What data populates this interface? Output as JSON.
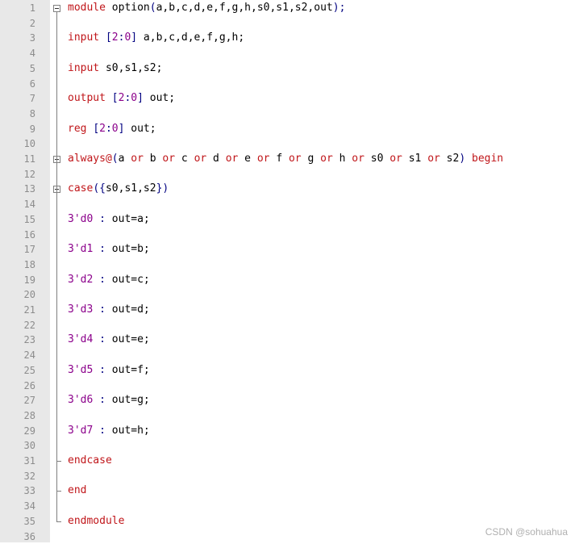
{
  "editor": {
    "line_numbers": [
      "1",
      "2",
      "3",
      "4",
      "5",
      "6",
      "7",
      "8",
      "9",
      "10",
      "11",
      "12",
      "13",
      "14",
      "15",
      "16",
      "17",
      "18",
      "19",
      "20",
      "21",
      "22",
      "23",
      "24",
      "25",
      "26",
      "27",
      "28",
      "29",
      "30",
      "31",
      "32",
      "33",
      "34",
      "35",
      "36"
    ],
    "code_lines": [
      {
        "line": 1,
        "tokens": [
          {
            "t": "kw",
            "v": "module"
          },
          {
            "t": "plain",
            "v": " option"
          },
          {
            "t": "op",
            "v": "("
          },
          {
            "t": "plain",
            "v": "a,b,c,d,e,f,g,h,s0,s1,s2,out"
          },
          {
            "t": "op",
            "v": ");"
          }
        ]
      },
      {
        "line": 3,
        "tokens": [
          {
            "t": "kw",
            "v": "input"
          },
          {
            "t": "plain",
            "v": " "
          },
          {
            "t": "op",
            "v": "["
          },
          {
            "t": "num",
            "v": "2"
          },
          {
            "t": "op",
            "v": ":"
          },
          {
            "t": "num",
            "v": "0"
          },
          {
            "t": "op",
            "v": "]"
          },
          {
            "t": "plain",
            "v": " a,b,c,d,e,f,g,h;"
          }
        ]
      },
      {
        "line": 5,
        "tokens": [
          {
            "t": "kw",
            "v": "input"
          },
          {
            "t": "plain",
            "v": " s0,s1,s2;"
          }
        ]
      },
      {
        "line": 7,
        "tokens": [
          {
            "t": "kw",
            "v": "output"
          },
          {
            "t": "plain",
            "v": " "
          },
          {
            "t": "op",
            "v": "["
          },
          {
            "t": "num",
            "v": "2"
          },
          {
            "t": "op",
            "v": ":"
          },
          {
            "t": "num",
            "v": "0"
          },
          {
            "t": "op",
            "v": "]"
          },
          {
            "t": "plain",
            "v": " out;"
          }
        ]
      },
      {
        "line": 9,
        "tokens": [
          {
            "t": "kw",
            "v": "reg"
          },
          {
            "t": "plain",
            "v": " "
          },
          {
            "t": "op",
            "v": "["
          },
          {
            "t": "num",
            "v": "2"
          },
          {
            "t": "op",
            "v": ":"
          },
          {
            "t": "num",
            "v": "0"
          },
          {
            "t": "op",
            "v": "]"
          },
          {
            "t": "plain",
            "v": " out;"
          }
        ]
      },
      {
        "line": 11,
        "tokens": [
          {
            "t": "kw",
            "v": "always@"
          },
          {
            "t": "op",
            "v": "("
          },
          {
            "t": "plain",
            "v": "a "
          },
          {
            "t": "kw",
            "v": "or"
          },
          {
            "t": "plain",
            "v": " b "
          },
          {
            "t": "kw",
            "v": "or"
          },
          {
            "t": "plain",
            "v": " c "
          },
          {
            "t": "kw",
            "v": "or"
          },
          {
            "t": "plain",
            "v": " d "
          },
          {
            "t": "kw",
            "v": "or"
          },
          {
            "t": "plain",
            "v": " e "
          },
          {
            "t": "kw",
            "v": "or"
          },
          {
            "t": "plain",
            "v": " f "
          },
          {
            "t": "kw",
            "v": "or"
          },
          {
            "t": "plain",
            "v": " g "
          },
          {
            "t": "kw",
            "v": "or"
          },
          {
            "t": "plain",
            "v": " h "
          },
          {
            "t": "kw",
            "v": "or"
          },
          {
            "t": "plain",
            "v": " s0 "
          },
          {
            "t": "kw",
            "v": "or"
          },
          {
            "t": "plain",
            "v": " s1 "
          },
          {
            "t": "kw",
            "v": "or"
          },
          {
            "t": "plain",
            "v": " s2"
          },
          {
            "t": "op",
            "v": ")"
          },
          {
            "t": "plain",
            "v": " "
          },
          {
            "t": "kw",
            "v": "begin"
          }
        ]
      },
      {
        "line": 13,
        "tokens": [
          {
            "t": "kw",
            "v": "case"
          },
          {
            "t": "op",
            "v": "({"
          },
          {
            "t": "plain",
            "v": "s0,s1,s2"
          },
          {
            "t": "op",
            "v": "})"
          }
        ]
      },
      {
        "line": 15,
        "tokens": [
          {
            "t": "num",
            "v": "3'd0"
          },
          {
            "t": "plain",
            "v": " "
          },
          {
            "t": "op",
            "v": ":"
          },
          {
            "t": "plain",
            "v": " out=a;"
          }
        ]
      },
      {
        "line": 17,
        "tokens": [
          {
            "t": "num",
            "v": "3'd1"
          },
          {
            "t": "plain",
            "v": " "
          },
          {
            "t": "op",
            "v": ":"
          },
          {
            "t": "plain",
            "v": " out=b;"
          }
        ]
      },
      {
        "line": 19,
        "tokens": [
          {
            "t": "num",
            "v": "3'd2"
          },
          {
            "t": "plain",
            "v": " "
          },
          {
            "t": "op",
            "v": ":"
          },
          {
            "t": "plain",
            "v": " out=c;"
          }
        ]
      },
      {
        "line": 21,
        "tokens": [
          {
            "t": "num",
            "v": "3'd3"
          },
          {
            "t": "plain",
            "v": " "
          },
          {
            "t": "op",
            "v": ":"
          },
          {
            "t": "plain",
            "v": " out=d;"
          }
        ]
      },
      {
        "line": 23,
        "tokens": [
          {
            "t": "num",
            "v": "3'd4"
          },
          {
            "t": "plain",
            "v": " "
          },
          {
            "t": "op",
            "v": ":"
          },
          {
            "t": "plain",
            "v": " out=e;"
          }
        ]
      },
      {
        "line": 25,
        "tokens": [
          {
            "t": "num",
            "v": "3'd5"
          },
          {
            "t": "plain",
            "v": " "
          },
          {
            "t": "op",
            "v": ":"
          },
          {
            "t": "plain",
            "v": " out=f;"
          }
        ]
      },
      {
        "line": 27,
        "tokens": [
          {
            "t": "num",
            "v": "3'd6"
          },
          {
            "t": "plain",
            "v": " "
          },
          {
            "t": "op",
            "v": ":"
          },
          {
            "t": "plain",
            "v": " out=g;"
          }
        ]
      },
      {
        "line": 29,
        "tokens": [
          {
            "t": "num",
            "v": "3'd7"
          },
          {
            "t": "plain",
            "v": " "
          },
          {
            "t": "op",
            "v": ":"
          },
          {
            "t": "plain",
            "v": " out=h;"
          }
        ]
      },
      {
        "line": 31,
        "tokens": [
          {
            "t": "kw",
            "v": "endcase"
          }
        ]
      },
      {
        "line": 33,
        "tokens": [
          {
            "t": "kw",
            "v": "end"
          }
        ]
      },
      {
        "line": 35,
        "tokens": [
          {
            "t": "kw",
            "v": "endmodule"
          }
        ]
      }
    ],
    "fold_markers": [
      {
        "line": 1,
        "icon": "fold-minus-icon"
      },
      {
        "line": 11,
        "icon": "fold-minus-icon"
      },
      {
        "line": 13,
        "icon": "fold-minus-icon"
      }
    ],
    "fold_ends": [
      31,
      33,
      35
    ],
    "colors": {
      "keyword": "#c0161a",
      "number": "#8b008b",
      "operator": "#000080",
      "plain": "#000000",
      "gutter_bg": "#e8e8e8",
      "line_number": "#8c8c8c"
    }
  },
  "watermark": "CSDN @sohuahua"
}
